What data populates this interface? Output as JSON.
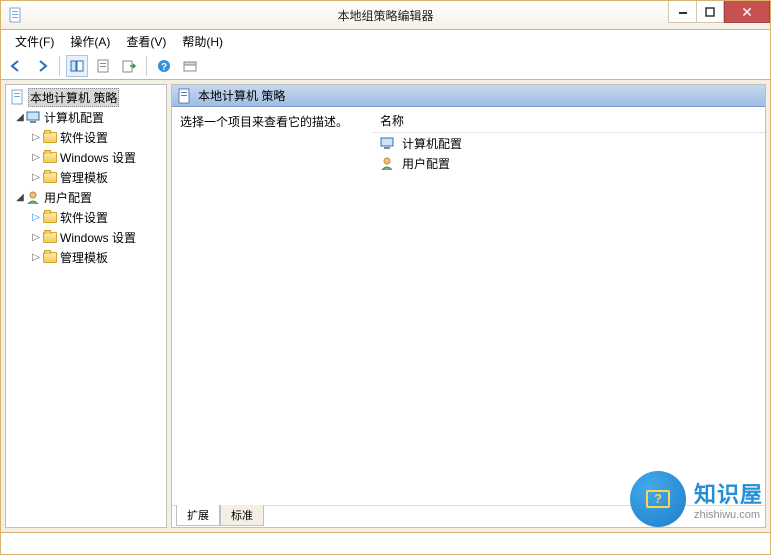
{
  "window": {
    "title": "本地组策略编辑器"
  },
  "menu": {
    "file": "文件(F)",
    "action": "操作(A)",
    "view": "查看(V)",
    "help": "帮助(H)"
  },
  "tree": {
    "root": "本地计算机 策略",
    "computer_config": "计算机配置",
    "software_settings_1": "软件设置",
    "windows_settings_1": "Windows 设置",
    "admin_templates_1": "管理模板",
    "user_config": "用户配置",
    "software_settings_2": "软件设置",
    "windows_settings_2": "Windows 设置",
    "admin_templates_2": "管理模板"
  },
  "details": {
    "header": "本地计算机 策略",
    "description": "选择一个项目来查看它的描述。",
    "column_name": "名称",
    "item_computer": "计算机配置",
    "item_user": "用户配置"
  },
  "tabs": {
    "extended": "扩展",
    "standard": "标准"
  },
  "branding": {
    "cn": "知识屋",
    "en": "zhishiwu.com"
  }
}
